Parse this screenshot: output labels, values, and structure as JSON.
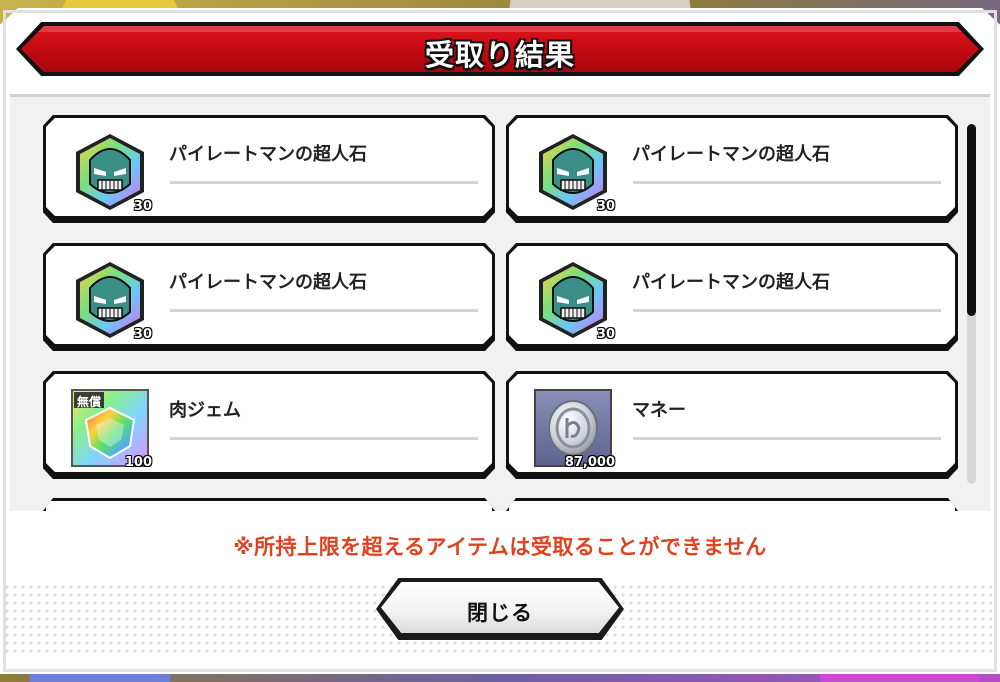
{
  "dialog": {
    "title": "受取り結果",
    "notice": "※所持上限を超えるアイテムは受取ることができません",
    "close_label": "閉じる"
  },
  "items": [
    {
      "name": "パイレートマンの超人石",
      "quantity": "30",
      "icon": "pirateman-stone-icon"
    },
    {
      "name": "パイレートマンの超人石",
      "quantity": "30",
      "icon": "pirateman-stone-icon"
    },
    {
      "name": "パイレートマンの超人石",
      "quantity": "30",
      "icon": "pirateman-stone-icon"
    },
    {
      "name": "パイレートマンの超人石",
      "quantity": "30",
      "icon": "pirateman-stone-icon"
    },
    {
      "name": "肉ジェム",
      "quantity": "100",
      "badge": "無償",
      "icon": "niku-gem-icon"
    },
    {
      "name": "マネー",
      "quantity": "87,000",
      "icon": "money-coin-icon"
    }
  ],
  "colors": {
    "banner_red": "#c10a12",
    "notice_red": "#e0421f",
    "panel_bg": "#f1f1f1"
  }
}
